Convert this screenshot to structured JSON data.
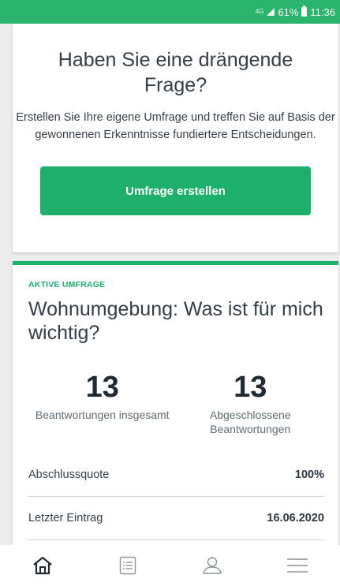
{
  "status_bar": {
    "network": "4G",
    "battery": "61%",
    "time": "11:36"
  },
  "prompt_card": {
    "title": "Haben Sie eine drängende Frage?",
    "text": "Erstellen Sie Ihre eigene Umfrage und treffen Sie auf Basis der gewonnenen Erkenntnisse fundiertere Entscheidungen.",
    "button_label": "Umfrage erstellen"
  },
  "survey_card": {
    "tag": "AKTIVE UMFRAGE",
    "title": "Wohnumgebung: Was ist für mich wichtig?",
    "stats": [
      {
        "value": "13",
        "label": "Beantwortungen insgesamt"
      },
      {
        "value": "13",
        "label": "Abgeschlossene Beantwortungen"
      }
    ],
    "rows": [
      {
        "label": "Abschlussquote",
        "value": "100%"
      },
      {
        "label": "Letzter Eintrag",
        "value": "16.06.2020"
      }
    ]
  },
  "bottom_nav": {
    "icons": [
      "home-icon",
      "list-icon",
      "user-icon",
      "menu-icon"
    ]
  },
  "colors": {
    "accent": "#1cb06b",
    "status_bar": "#2ab56b",
    "text": "#333e48"
  }
}
